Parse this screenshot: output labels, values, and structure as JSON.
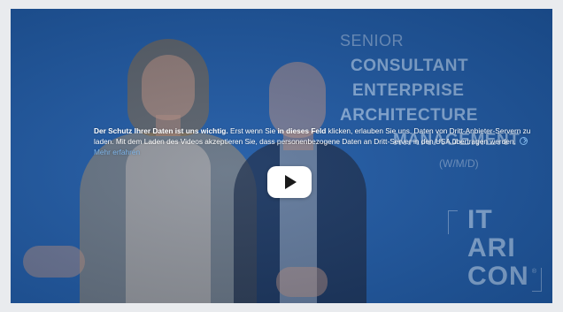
{
  "video": {
    "background_color": "#1f5aa6",
    "job_title": {
      "line1": "SENIOR",
      "line2": "CONSULTANT",
      "line3": "ENTERPRISE",
      "line4": "ARCHITECTURE",
      "line5": "MANAGEMENT",
      "line6": "(W/M/D)"
    },
    "logo": {
      "line1": "IT",
      "line2": "ARI",
      "line3": "CON",
      "reg": "®"
    }
  },
  "privacy_notice": {
    "bold_intro": "Der Schutz Ihrer Daten ist uns wichtig.",
    "text_a": " Erst wenn Sie ",
    "bold_field": "in dieses Feld",
    "text_b": " klicken, erlauben Sie uns, Daten von Dritt-Anbieter-Servern zu laden. Mit dem Laden des Videos akzeptieren Sie, dass personenbezogene Daten an Dritt-Server in den USA übertragen werden.",
    "more_link": "Mehr erfahren",
    "link_color": "#7fb6ea"
  },
  "play_button": {
    "icon": "play-icon"
  }
}
